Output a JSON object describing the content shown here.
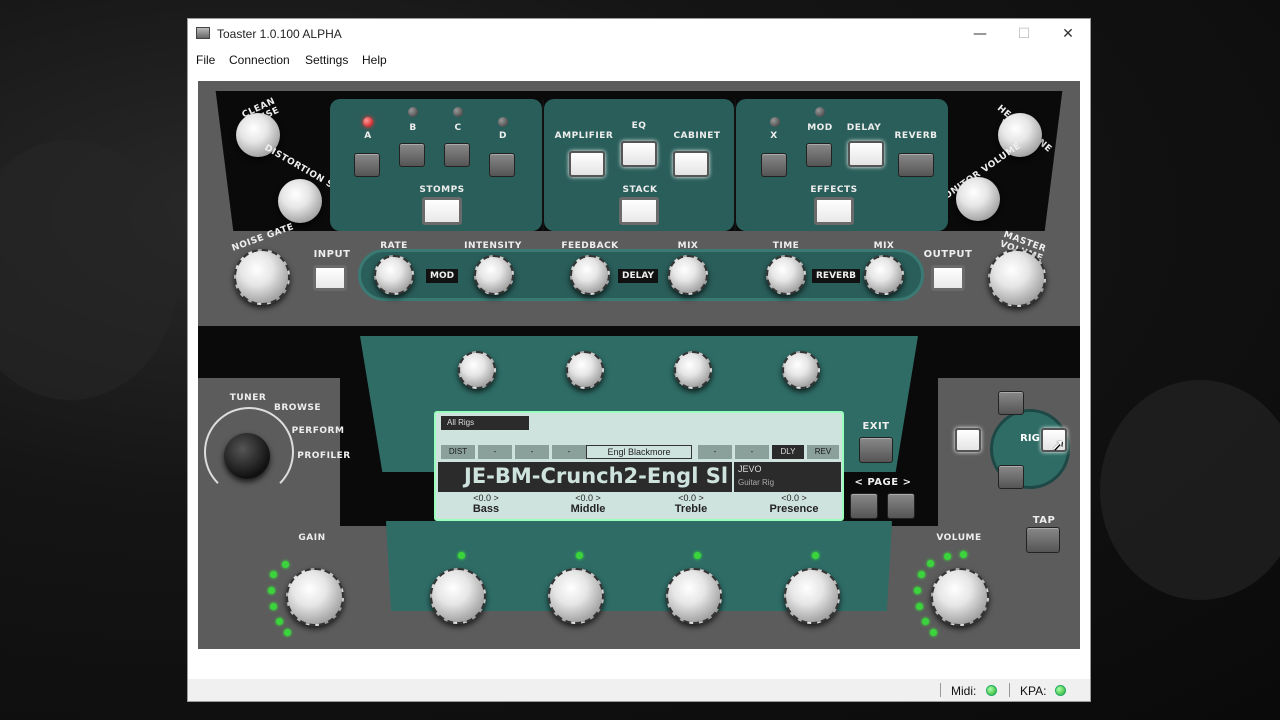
{
  "window": {
    "title": "Toaster 1.0.100 ALPHA",
    "controls": {
      "minimize": "—",
      "maximize": "☐",
      "close": "✕"
    }
  },
  "menu": [
    "File",
    "Connection",
    "Settings",
    "Help"
  ],
  "top_knobs": {
    "clean_sense": "CLEAN SENSE",
    "distortion_sense": "DISTORTION SENSE",
    "headphone_volume": "HEADPHONE VOLUME",
    "monitor_volume": "MONITOR VOLUME"
  },
  "stomps": {
    "slots": [
      "A",
      "B",
      "C",
      "D"
    ],
    "button": "STOMPS"
  },
  "stack": {
    "slots": [
      "AMPLIFIER",
      "EQ",
      "CABINET"
    ],
    "button": "STACK"
  },
  "effects": {
    "slots": [
      "X",
      "MOD",
      "DELAY",
      "REVERB"
    ],
    "button": "EFFECTS"
  },
  "fx_row": {
    "noise_gate": "NOISE GATE",
    "input": "INPUT",
    "output": "OUTPUT",
    "master_volume": "MASTER VOLUME",
    "mod": {
      "label": "MOD",
      "knobs": [
        "RATE",
        "INTENSITY"
      ]
    },
    "delay": {
      "label": "DELAY",
      "knobs": [
        "FEEDBACK",
        "MIX"
      ]
    },
    "reverb": {
      "label": "REVERB",
      "knobs": [
        "TIME",
        "MIX"
      ]
    }
  },
  "mode_selector": [
    "TUNER",
    "BROWSE",
    "PERFORM",
    "PROFILER"
  ],
  "lcd": {
    "tab": "All Rigs",
    "slots": [
      "DIST",
      "-",
      "-",
      "-",
      "-",
      "-",
      "DLY",
      "REV"
    ],
    "amp": "Engl Blackmore",
    "rig_name": "JE-BM-Crunch2-Engl Sl",
    "author": "JEVO",
    "author_sub": "Guitar Rig",
    "params": [
      {
        "value": "<0.0 >",
        "name": "Bass"
      },
      {
        "value": "<0.0 >",
        "name": "Middle"
      },
      {
        "value": "<0.0 >",
        "name": "Treble"
      },
      {
        "value": "<0.0 >",
        "name": "Presence"
      }
    ]
  },
  "right_controls": {
    "exit": "EXIT",
    "page": "< PAGE >",
    "rig": "RIG",
    "tap": "TAP"
  },
  "bottom_knobs": {
    "gain": "GAIN",
    "volume": "VOLUME"
  },
  "statusbar": {
    "midi_label": "Midi:",
    "kpa_label": "KPA:"
  },
  "colors": {
    "teal": "#2f6c66",
    "led_green": "#3cd43c",
    "led_red": "#c40000"
  }
}
